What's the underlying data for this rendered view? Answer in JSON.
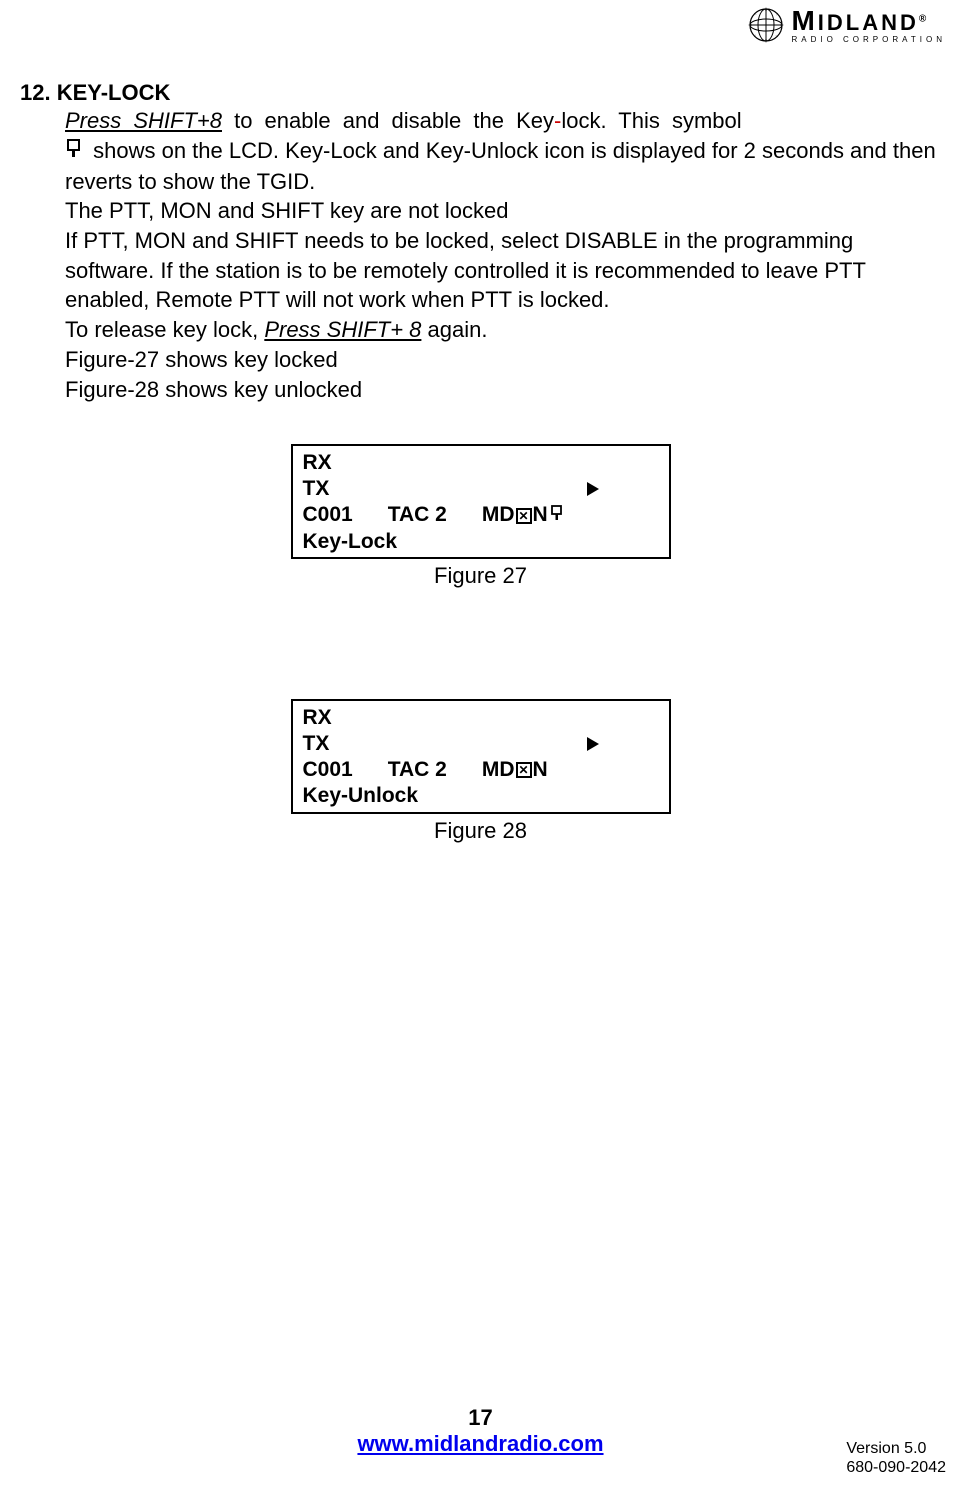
{
  "logo": {
    "brand_m": "M",
    "brand_rest": "IDLAND",
    "sub": "RADIO   CORPORATION"
  },
  "section": {
    "number_title": "12. KEY-LOCK",
    "line1_a": "Press SHIFT+8",
    "line1_b": " to enable and disable the Key",
    "line1_c": "-",
    "line1_d": "lock. This symbol",
    "line2": " shows on the LCD. Key-Lock and Key-Unlock icon is displayed for 2 seconds and then reverts to show the TGID.",
    "line3": "The PTT, MON and SHIFT key are not locked",
    "line4": "If PTT, MON and SHIFT needs to be locked, select DISABLE in the programming software. If the station is to be remotely controlled it is recommended to leave PTT enabled, Remote PTT will not work when PTT is locked.",
    "line5_a": "To release key lock, ",
    "line5_b": "Press SHIFT+ 8",
    "line5_c": " again.",
    "line6": "Figure-27 shows key locked",
    "line7": "Figure-28 shows key unlocked"
  },
  "lcd1": {
    "rx": "RX",
    "tx": "TX",
    "c001": "C001",
    "tac": "TAC 2",
    "md": "MD",
    "n": "N",
    "status": "Key-Lock",
    "caption": "Figure 27"
  },
  "lcd2": {
    "rx": "RX",
    "tx": "TX",
    "c001": "C001",
    "tac": "TAC 2",
    "md": "MD",
    "n": "N",
    "status": "Key-Unlock",
    "caption": "Figure 28"
  },
  "footer": {
    "page": "17",
    "url": "www.midlandradio.com",
    "version": "Version 5.0",
    "doc": "680-090-2042"
  }
}
